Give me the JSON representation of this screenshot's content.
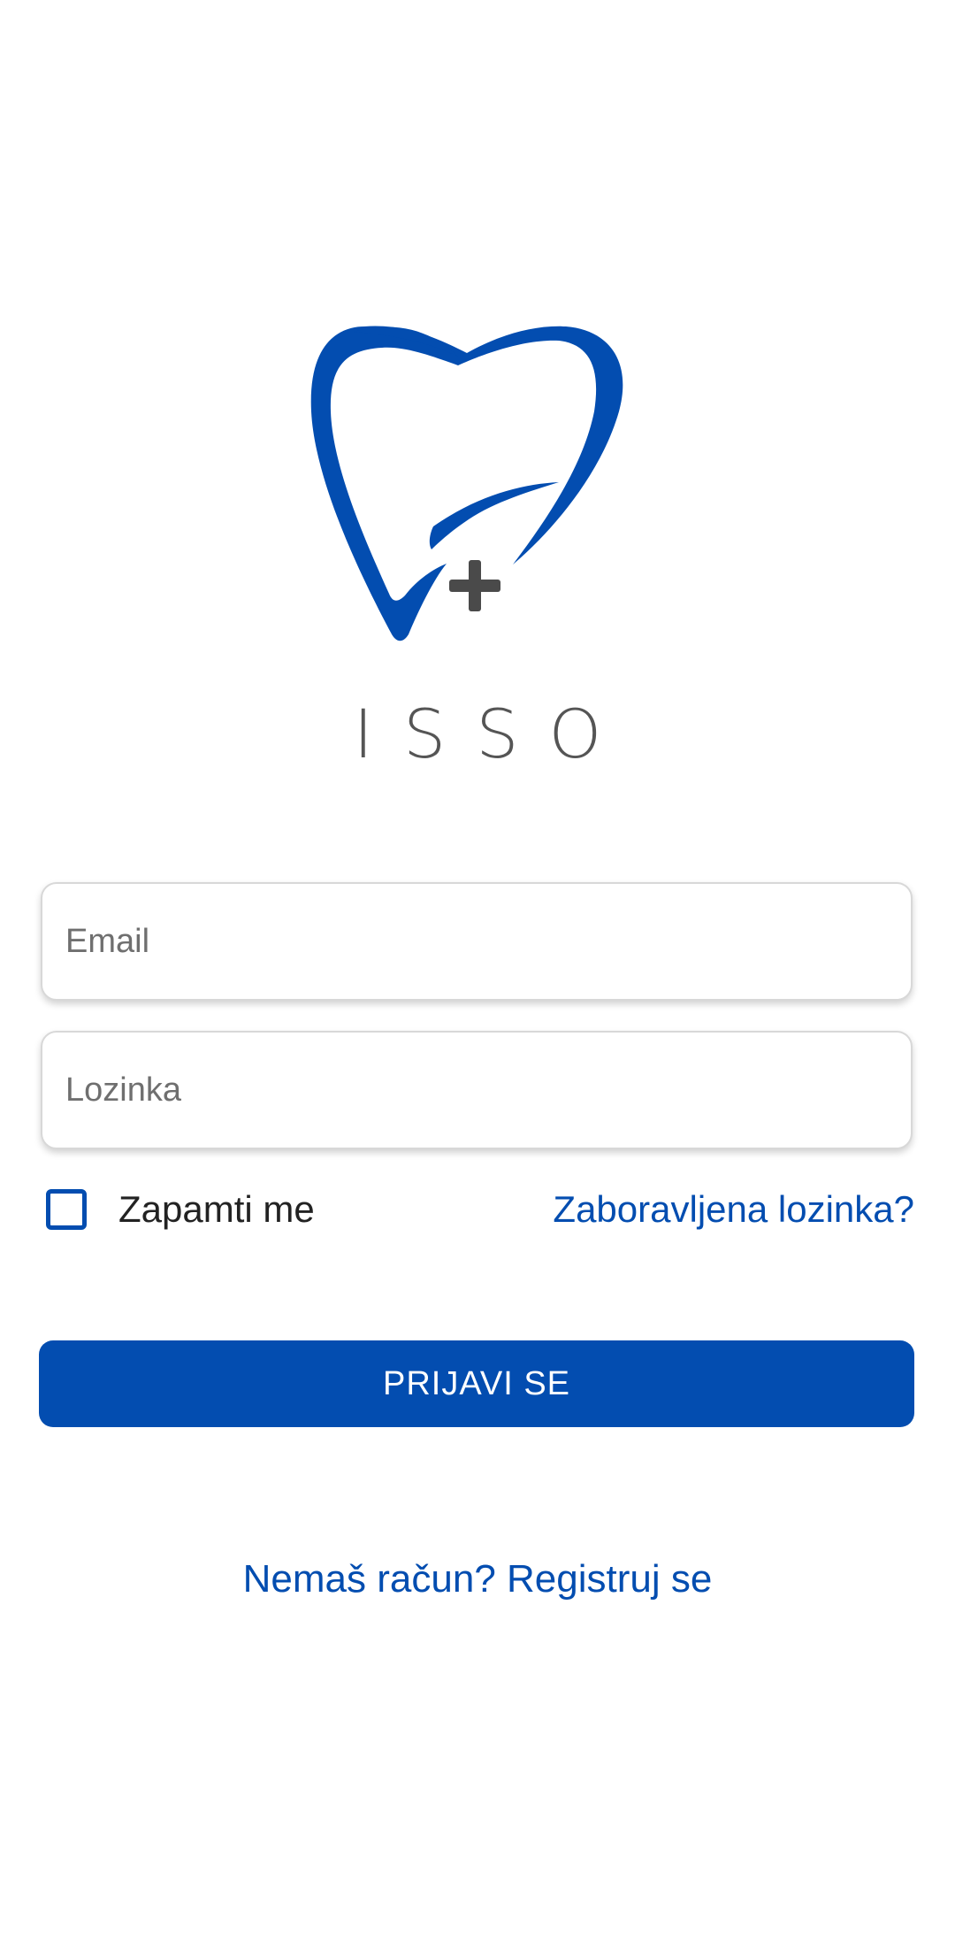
{
  "logo": {
    "icon": "tooth-plus-icon",
    "brand_name": "ISSO",
    "colors": {
      "tooth": "#034db0",
      "plus": "#4a4a4a",
      "brand_text": "#555555"
    }
  },
  "form": {
    "email_placeholder": "Email",
    "email_value": "",
    "password_placeholder": "Lozinka",
    "password_value": "",
    "remember_label": "Zapamti me",
    "remember_checked": false,
    "forgot_link": "Zaboravljena lozinka?",
    "login_button": "PRIJAVI SE",
    "register_link": "Nemaš račun? Registruj se"
  },
  "theme": {
    "accent": "#034db0",
    "background": "#ffffff"
  }
}
